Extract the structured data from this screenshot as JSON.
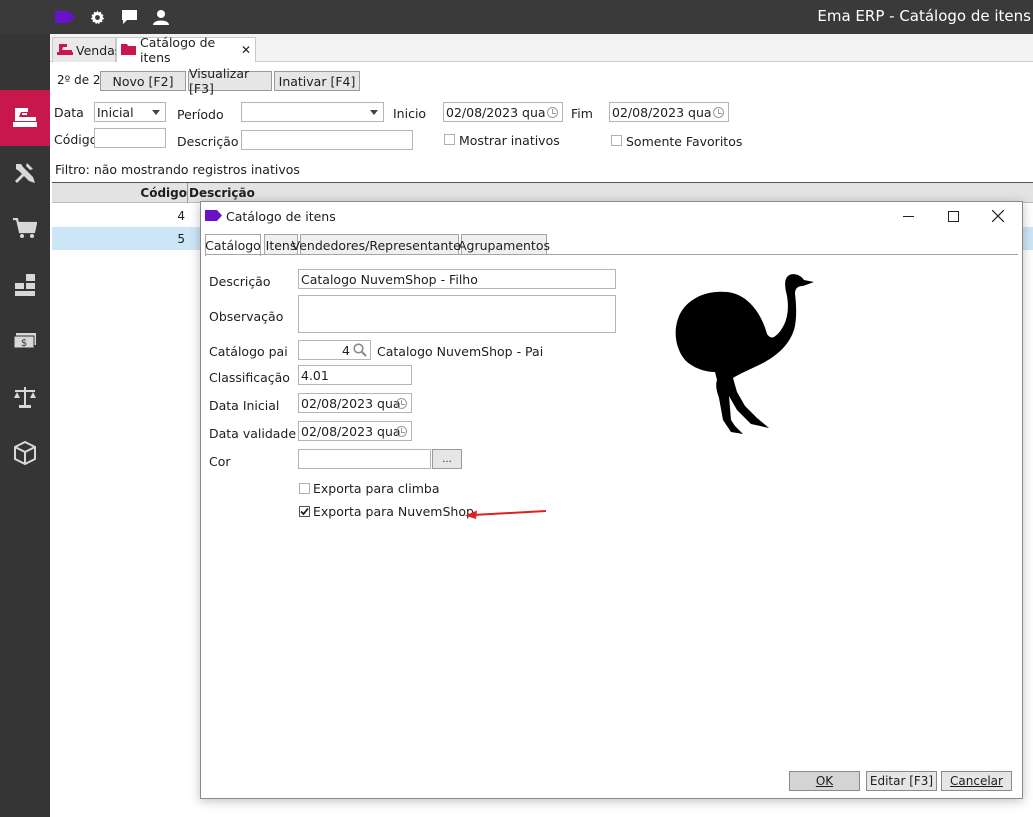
{
  "app": {
    "title": "Ema ERP - Catálogo de itens"
  },
  "tabs": [
    {
      "label": "Vendas"
    },
    {
      "label": "Catálogo de itens"
    }
  ],
  "toolbar": {
    "page_indicator": "2º de 2",
    "new_label": "Novo [F2]",
    "view_label": "Visualizar [F3]",
    "deactivate_label": "Inativar [F4]"
  },
  "filters": {
    "date_label": "Data",
    "date_value": "Inicial",
    "period_label": "Período",
    "period_value": "",
    "start_label": "Inicio",
    "start_value": "02/08/2023 qua",
    "end_label": "Fim",
    "end_value": "02/08/2023 qua",
    "code_label": "Código",
    "code_value": "",
    "description_label": "Descrição",
    "description_value": "",
    "show_inactive_label": "Mostrar inativos",
    "show_inactive_checked": false,
    "favorites_label": "Somente Favoritos",
    "favorites_checked": false
  },
  "filter_text": "Filtro:  não mostrando registros inativos",
  "grid": {
    "columns": [
      "Código",
      "Descrição"
    ],
    "rows": [
      {
        "code": "4",
        "selected": false
      },
      {
        "code": "5",
        "selected": true
      }
    ]
  },
  "dialog": {
    "title": "Catálogo de itens",
    "tabs": [
      "Catálogo",
      "Itens",
      "Vendedores/Representantes",
      "Agrupamentos"
    ],
    "active_tab": "Catálogo",
    "fields": {
      "descricao_label": "Descrição",
      "descricao_value": "Catalogo NuvemShop - Filho",
      "observacao_label": "Observação",
      "observacao_value": "",
      "catalogo_pai_label": "Catálogo pai",
      "catalogo_pai_code": "4",
      "catalogo_pai_name": "Catalogo NuvemShop - Pai",
      "classificacao_label": "Classificação",
      "classificacao_value": "4.01",
      "data_inicial_label": "Data Inicial",
      "data_inicial_value": "02/08/2023 qua",
      "data_validade_label": "Data validade",
      "data_validade_value": "02/08/2023 qua",
      "cor_label": "Cor",
      "cor_value": "",
      "cor_button": "...",
      "exporta_climba_label": "Exporta para climba",
      "exporta_climba_checked": false,
      "exporta_nuvemshop_label": "Exporta para NuvemShop",
      "exporta_nuvemshop_checked": true
    },
    "buttons": {
      "ok": "OK",
      "edit": "Editar [F3]",
      "cancel": "Cancelar"
    }
  },
  "colors": {
    "accent": "#c8174a",
    "logo": "#6a12c8",
    "selection": "#cde6f7",
    "arrow": "#e0201e"
  },
  "icons": {
    "sidebar": [
      "sales-register-icon",
      "tools-icon",
      "cart-icon",
      "stock-icon",
      "finance-icon",
      "scale-icon",
      "package-icon"
    ],
    "topbar": [
      "logo-icon",
      "gear-icon",
      "chat-icon",
      "user-icon"
    ]
  }
}
